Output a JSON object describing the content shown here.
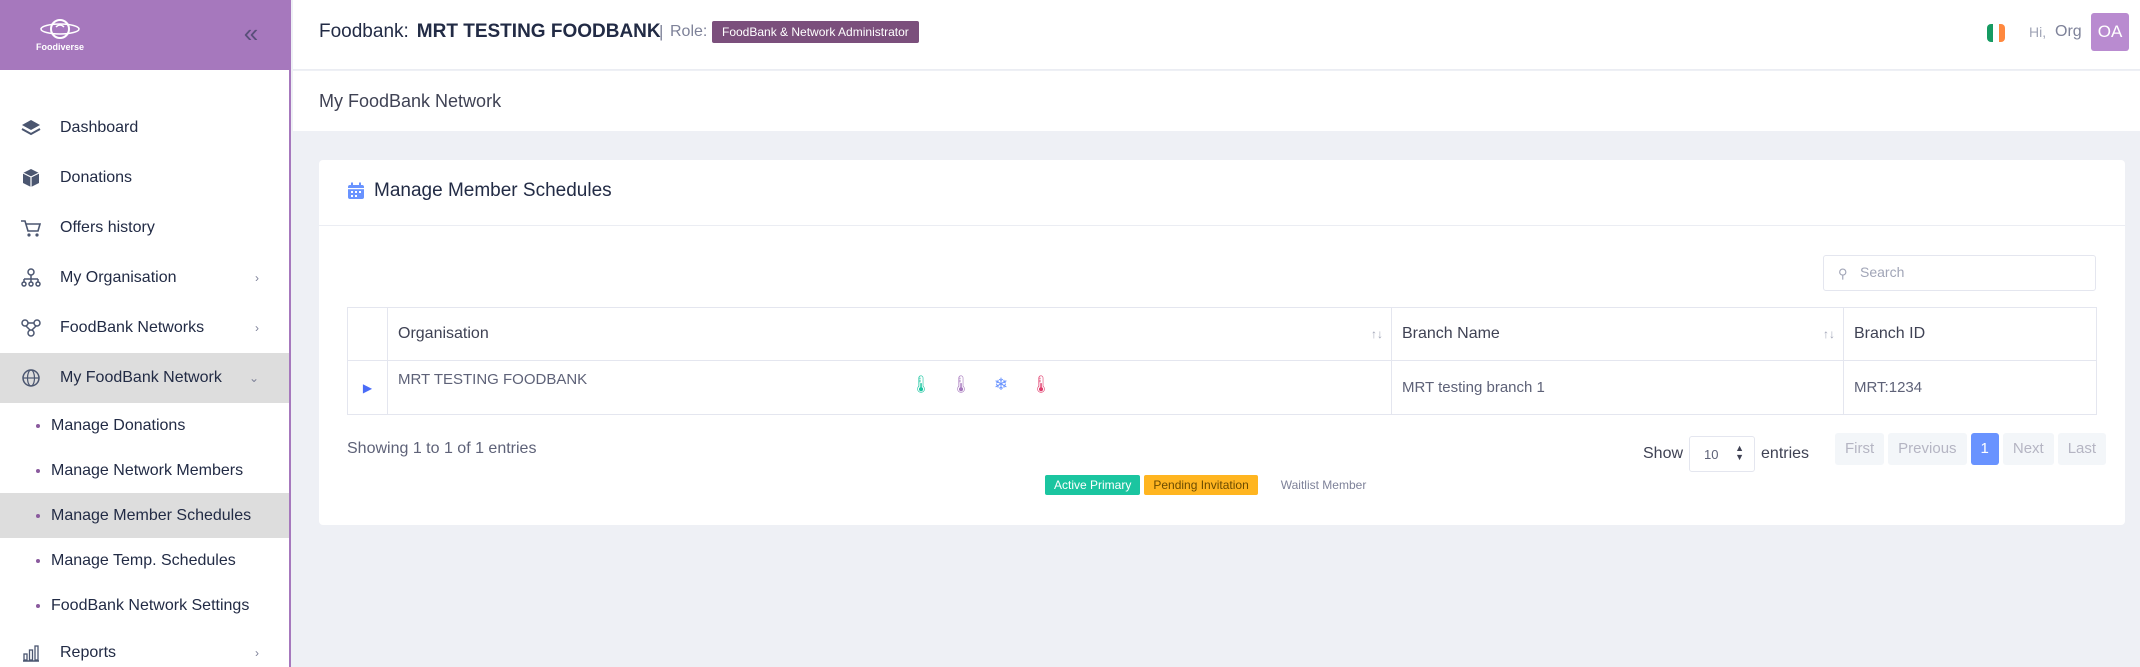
{
  "sidebar": {
    "logo_text": "Foodiverse",
    "items": [
      {
        "label": "Dashboard"
      },
      {
        "label": "Donations"
      },
      {
        "label": "Offers history"
      },
      {
        "label": "My Organisation"
      },
      {
        "label": "FoodBank Networks"
      },
      {
        "label": "My FoodBank Network"
      }
    ],
    "sub_items": [
      {
        "label": "Manage Donations"
      },
      {
        "label": "Manage Network Members"
      },
      {
        "label": "Manage Member Schedules"
      },
      {
        "label": "Manage Temp. Schedules"
      },
      {
        "label": "FoodBank Network Settings"
      }
    ],
    "reports": {
      "label": "Reports"
    }
  },
  "header": {
    "foodbank_label": "Foodbank:",
    "foodbank_name": "MRT TESTING FOODBANK",
    "separator": "|",
    "role_label": "Role:",
    "role_badge": "FoodBank & Network Administrator",
    "greeting": "Hi,",
    "user": "Org",
    "avatar_initials": "OA",
    "flag_colors": [
      "#169b62",
      "#ffffff",
      "#ff883e"
    ]
  },
  "subheader": {
    "title": "My FoodBank Network"
  },
  "card": {
    "title": "Manage Member Schedules",
    "search_placeholder": "Search",
    "columns": [
      "Organisation",
      "Branch Name",
      "Branch ID"
    ],
    "rows": [
      {
        "organisation": "MRT TESTING FOODBANK",
        "branch_name": "MRT testing branch 1",
        "branch_id": "MRT:1234"
      }
    ],
    "showing": "Showing 1 to 1 of 1 entries",
    "legend": {
      "active": "Active Primary",
      "pending": "Pending Invitation",
      "waitlist": "Waitlist Member"
    },
    "show_label": "Show",
    "entries_value": "10",
    "entries_label": "entries",
    "pager": {
      "first": "First",
      "previous": "Previous",
      "current": "1",
      "next": "Next",
      "last": "Last"
    }
  },
  "colors": {
    "brand": "#a678bd",
    "accent": "#6993ff",
    "green": "#1bc5a0",
    "orange": "#ffb520"
  }
}
